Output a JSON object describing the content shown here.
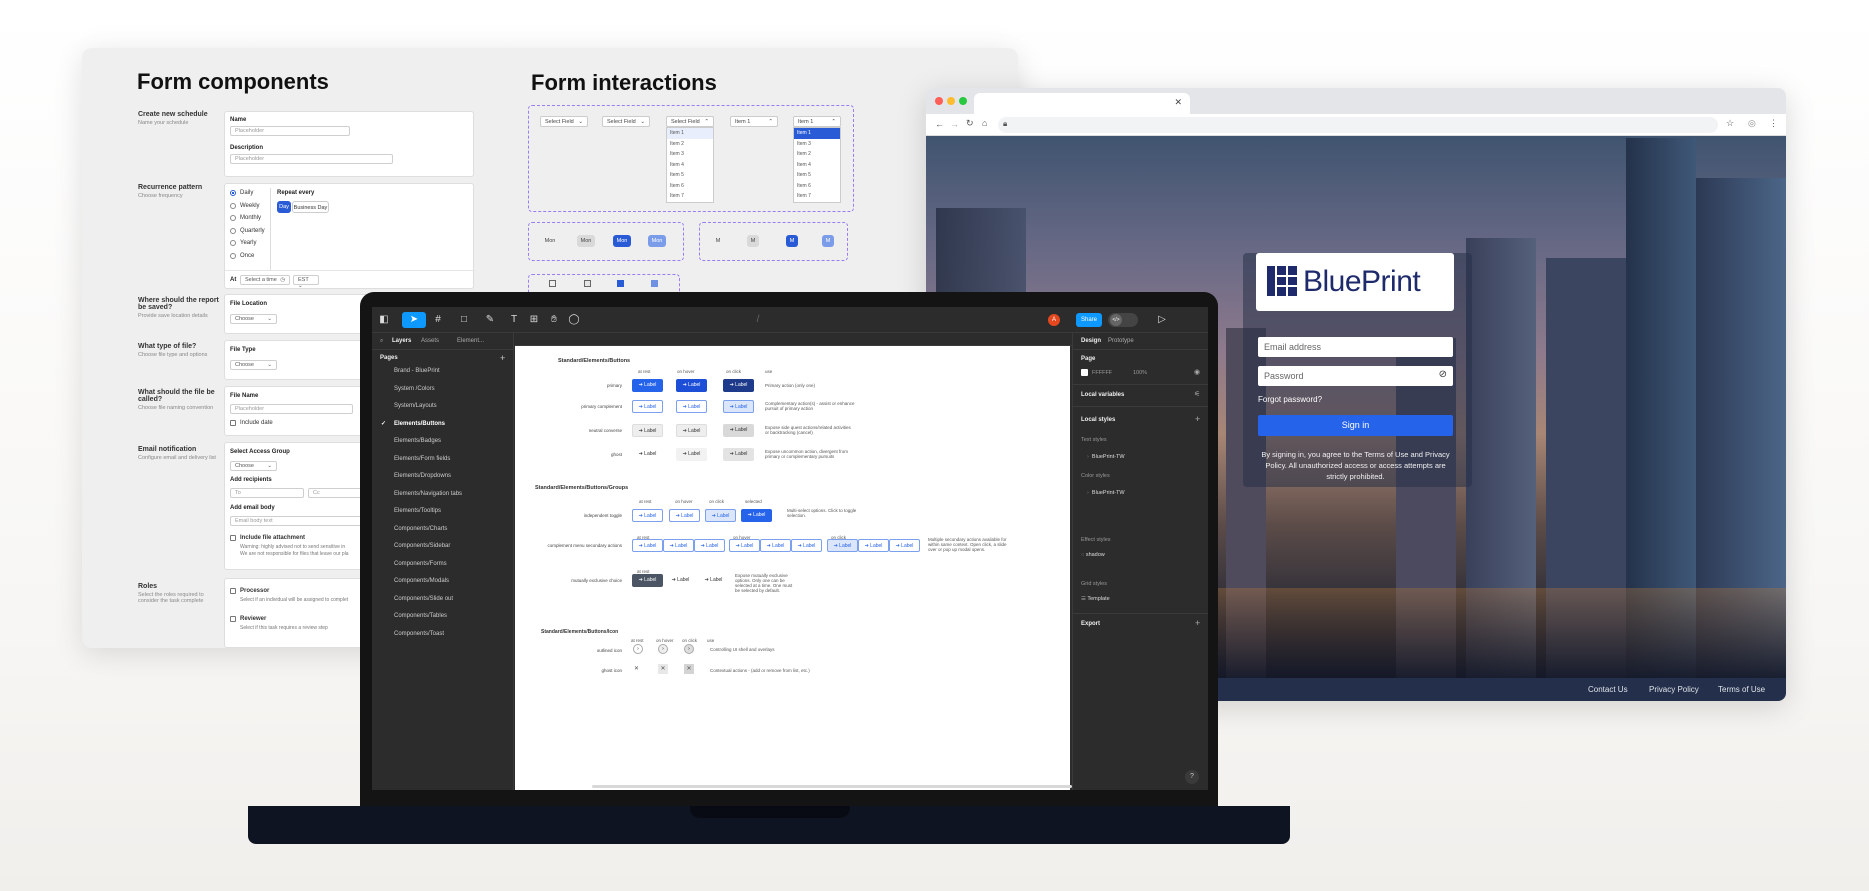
{
  "form_panel": {
    "title_left": "Form components",
    "title_right": "Form interactions",
    "schedule": {
      "title": "Create new schedule",
      "sub": "Name your schedule",
      "name_label": "Name",
      "name_placeholder": "Placeholder",
      "desc_label": "Description",
      "desc_placeholder": "Placeholder"
    },
    "recurrence": {
      "title": "Recurrence pattern",
      "sub": "Choose frequency",
      "options": [
        "Daily",
        "Weekly",
        "Monthly",
        "Quarterly",
        "Yearly",
        "Once"
      ],
      "repeat_label": "Repeat every",
      "repeat_chips": [
        "Day",
        "Business Day"
      ],
      "at_label": "At",
      "time_placeholder": "Select a time",
      "tz": "EST"
    },
    "save": {
      "title": "Where should the report be saved?",
      "sub": "Provide save location details",
      "label": "File Location",
      "value": "Choose"
    },
    "filetype": {
      "title": "What type of file?",
      "sub": "Choose file type and options",
      "label": "File Type",
      "value": "Choose"
    },
    "filename": {
      "title": "What should the file be called?",
      "sub": "Choose file naming convention",
      "label": "File Name",
      "placeholder": "Placeholder",
      "include_date": "Include date"
    },
    "email": {
      "title": "Email notification",
      "sub": "Configure email and delivery list",
      "access_label": "Select Access Group",
      "access_value": "Choose",
      "recipients_label": "Add recipients",
      "to": "To",
      "cc": "Cc",
      "body_label": "Add email body",
      "body_placeholder": "Email body text",
      "attach_label": "Include file attachment",
      "attach_warning_1": "Warning: highly advised not to send sensitive in",
      "attach_warning_2": "We are not responsible for files that leave our pla"
    },
    "roles": {
      "title": "Roles",
      "sub_1": "Select the roles required to",
      "sub_2": "consider the task complete",
      "processor": "Processor",
      "processor_sub": "Select if an individual will be assigned to complet",
      "reviewer": "Reviewer",
      "reviewer_sub": "Select if this task requires a review step"
    },
    "interactions": {
      "select_label": "Select Field",
      "item_label": "Item 1",
      "list_items": [
        "Item 1",
        "Item 2",
        "Item 3",
        "Item 4",
        "Item 5",
        "Item 6",
        "Item 7"
      ],
      "day_pills": [
        "Mon",
        "Mon",
        "Mon",
        "Mon"
      ],
      "day_short": [
        "M",
        "M",
        "M",
        "M"
      ]
    }
  },
  "browser": {
    "brand": "BluePrint",
    "email_placeholder": "Email address",
    "password_placeholder": "Password",
    "forgot": "Forgot password?",
    "signin": "Sign in",
    "disclaimer": "By signing in, you agree to the Terms of Use and Privacy Policy. All unauthorized access or access attempts are strictly prohibited.",
    "footer_links": [
      "Contact Us",
      "Privacy Policy",
      "Terms of Use"
    ]
  },
  "figma": {
    "share": "Share",
    "avatar": "A",
    "tabs_left": [
      "Layers",
      "Assets",
      "Element..."
    ],
    "pages_label": "Pages",
    "pages": [
      "Brand - BluePrint",
      "System /Colors",
      "System/Layouts",
      "Elements/Buttons",
      "Elements/Badges",
      "Elements/Form fields",
      "Elements/Dropdowns",
      "Elements/Navigation tabs",
      "Elements/Tooltips",
      "Components/Charts",
      "Components/Sidebar",
      "Components/Forms",
      "Components/Modals",
      "Components/Slide out",
      "Components/Tables",
      "Components/Toast"
    ],
    "active_page_index": 3,
    "right_tabs": [
      "Design",
      "Prototype"
    ],
    "page_section": "Page",
    "page_color": "FFFFFF",
    "page_opacity": "100%",
    "local_variables": "Local variables",
    "local_styles": "Local styles",
    "text_styles": "Text styles",
    "text_style_item": "BluePrint-TW",
    "color_styles": "Color styles",
    "color_style_item": "BluePrint-TW",
    "effect_styles": "Effect styles",
    "effect_item": "shadow",
    "grid_styles": "Grid styles",
    "grid_item": "Template",
    "export": "Export",
    "help": "?",
    "canvas": {
      "sec1": "Standard/Elements/Buttons",
      "state_cols": [
        "at rest",
        "on hover",
        "on click",
        "use"
      ],
      "rows": [
        {
          "name": "primary",
          "use": "Primary action (only one)"
        },
        {
          "name": "primary complement",
          "use": "Complementary action(s) - assist or enhance pursuit of primary action"
        },
        {
          "name": "neutral converse",
          "use": "Expose side quest actions/related activities or backtracking (cancel)"
        },
        {
          "name": "ghost",
          "use": "Expose uncommon action, divergent from primary or complementary pursuits"
        }
      ],
      "btn_label": "Label",
      "sec2": "Standard/Elements/Buttons/Groups",
      "group_cols": [
        "at rest",
        "on hover",
        "on click",
        "selected"
      ],
      "g1_name": "independent toggle",
      "g1_use": "Multi-select options. Click to toggle selection.",
      "g2_name": "complement menu secondary actions",
      "g2_use": "Multiple secondary actions available for within same context. Open click, a slide over or pop up modal opens.",
      "g3_name": "mutually exclusive choice",
      "g3_use": "Expose mutually exclusive options. Only one can be selected at a time. One must be selected by default.",
      "sec3": "Standard/Elements/Buttons/Icon",
      "icon_cols": [
        "at rest",
        "on hover",
        "on click",
        "use"
      ],
      "icon_rows": [
        {
          "name": "outlined icon",
          "use": "Controlling UI shell and overlays"
        },
        {
          "name": "ghost icon",
          "use": "Contextual actions - (add or remove from list, etc.)"
        }
      ]
    }
  }
}
